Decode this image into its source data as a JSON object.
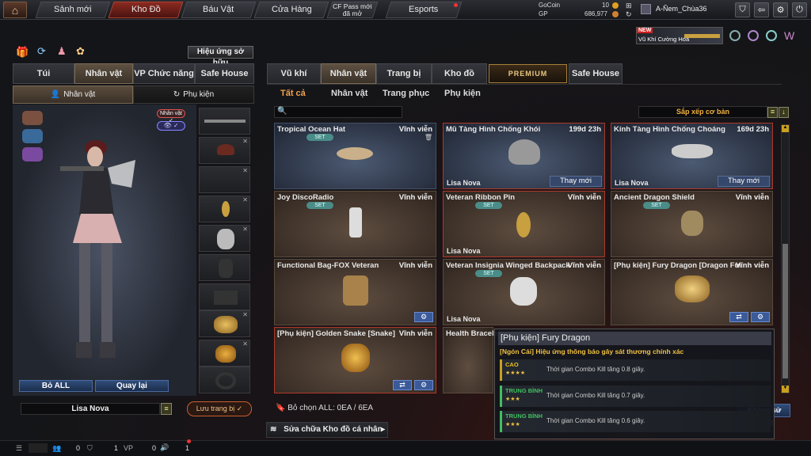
{
  "nav": {
    "tabs": [
      "Sảnh mới",
      "Kho Đồ",
      "Báu Vật",
      "Cửa Hàng",
      "CF Pass mới đã mở",
      "Esports"
    ],
    "active": "Kho Đồ"
  },
  "currency": {
    "gocoin_label": "GoCoin",
    "gocoin_value": "10",
    "gp_label": "GP",
    "gp_value": "686,977"
  },
  "player": {
    "name": "A-Ñem_Chùa36"
  },
  "promo": {
    "badge": "NEW",
    "label": "Vũ Khí Cường Hóa"
  },
  "left": {
    "effects_button": "Hiệu ứng sở hữu",
    "tabs": [
      "Túi",
      "Nhân vật",
      "VP Chức năng",
      "Safe House"
    ],
    "active_tab": "Nhân vật",
    "subtabs": [
      "Nhân vật",
      "Phụ kiện"
    ],
    "char_badge": "Nhân vật",
    "remove_all": "Bỏ ALL",
    "back": "Quay lại",
    "char_name": "Lisa Nova",
    "save": "Lưu trang bị"
  },
  "right": {
    "tabs": [
      "Vũ khí",
      "Nhân vật",
      "Trang bị",
      "Kho đồ",
      "PREMIUM",
      "Safe House"
    ],
    "active_tab": "Nhân vật",
    "subtabs": [
      "Tất cả",
      "Nhân vật",
      "Trang phục",
      "Phụ kiện"
    ],
    "active_subtab": "Tất cả",
    "sort_label": "Sắp xếp cơ bản",
    "items": [
      {
        "name": "Tropical Ocean Hat",
        "duration": "Vĩnh viễn",
        "set": "SET",
        "owner": "",
        "action": ""
      },
      {
        "name": "Mũ Tàng Hình Chống Khói",
        "duration": "199d 23h",
        "set": "",
        "owner": "Lisa Nova",
        "action": "Thay mới"
      },
      {
        "name": "Kính Tàng Hình Chống Choáng",
        "duration": "169d 23h",
        "set": "",
        "owner": "Lisa Nova",
        "action": "Thay mới"
      },
      {
        "name": "Joy DiscoRadio",
        "duration": "Vĩnh viễn",
        "set": "SET",
        "owner": "",
        "action": ""
      },
      {
        "name": "Veteran Ribbon Pin",
        "duration": "Vĩnh viễn",
        "set": "SET",
        "owner": "Lisa Nova",
        "action": ""
      },
      {
        "name": "Ancient Dragon Shield",
        "duration": "Vĩnh viễn",
        "set": "SET",
        "owner": "",
        "action": ""
      },
      {
        "name": "Functional Bag-FOX Veteran",
        "duration": "Vĩnh viễn",
        "set": "",
        "owner": "",
        "action": ""
      },
      {
        "name": "Veteran Insignia Winged Backpack",
        "duration": "Vĩnh viễn",
        "set": "SET",
        "owner": "Lisa Nova",
        "action": ""
      },
      {
        "name": "[Phụ kiện] Fury Dragon [Dragon Fury]",
        "duration": "Vĩnh viễn",
        "set": "",
        "owner": "",
        "action": ""
      },
      {
        "name": "[Phụ kiện] Golden Snake [Snake]",
        "duration": "Vĩnh viễn",
        "set": "",
        "owner": "",
        "action": ""
      },
      {
        "name": "Health Bracelet",
        "duration": "",
        "set": "",
        "owner": "",
        "action": ""
      }
    ],
    "selected_count": "Bỏ chọn ALL: 0EA / 6EA",
    "repair_label": "Sửa chữa Kho đồ cá nhân",
    "hidden_button": "Không sử dụng"
  },
  "tooltip": {
    "title": "[Phụ kiện] Fury Dragon",
    "subtitle": "[Ngón Cái] Hiệu ứng thông báo gây sát thương chính xác",
    "rows": [
      {
        "level": "CAO",
        "stars": "★★★★",
        "desc": "Thời gian Combo Kill tăng 0.8 giây.",
        "color": "#e8c020"
      },
      {
        "level": "TRUNG BÌNH",
        "stars": "★★★",
        "desc": "Thời gian Combo Kill tăng 0.7 giây.",
        "color": "#40c060"
      },
      {
        "level": "TRUNG BÌNH",
        "stars": "★★★",
        "desc": "Thời gian Combo Kill tăng 0.6 giây.",
        "color": "#40c060"
      }
    ]
  },
  "status": {
    "a": "0",
    "b": "1",
    "c": "0",
    "d": "1"
  }
}
